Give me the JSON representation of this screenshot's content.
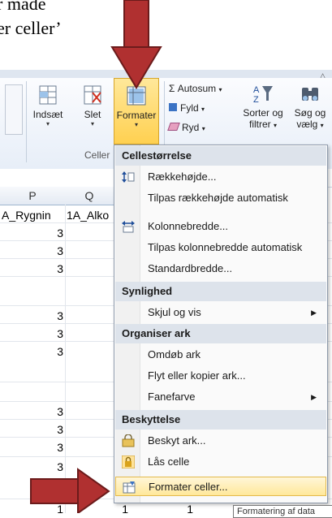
{
  "instruction": {
    "line1": "r måde",
    "line2": "er celler’"
  },
  "ribbon": {
    "insert_label": "Indsæt",
    "delete_label": "Slet",
    "format_label": "Formater",
    "cells_group_label": "Celler",
    "autosum_label": "Σ  Autosum",
    "fill_label": "Fyld",
    "clear_label": "Ryd",
    "sort_filter_label_1": "Sorter og",
    "sort_filter_label_2": "filtrer",
    "find_select_label_1": "Søg og",
    "find_select_label_2": "vælg"
  },
  "sheet": {
    "column_headers": [
      "P",
      "Q"
    ],
    "header_cells": [
      "A_Rygnin",
      "1A_Alko"
    ],
    "col_p_values": [
      "3",
      "3",
      "3",
      "",
      "3",
      "3",
      "3",
      "",
      "",
      "3",
      "3",
      "3",
      "3",
      "",
      "1"
    ],
    "bottom_row": [
      "1",
      "1",
      "1"
    ]
  },
  "menu": {
    "section_cell_size": "Cellestørrelse",
    "row_height": "Rækkehøjde...",
    "autofit_row_height": "Tilpas rækkehøjde automatisk",
    "column_width": "Kolonnebredde...",
    "autofit_column_width": "Tilpas kolonnebredde automatisk",
    "default_width": "Standardbredde...",
    "section_visibility": "Synlighed",
    "hide_unhide": "Skjul og vis",
    "section_organize": "Organiser ark",
    "rename_sheet": "Omdøb ark",
    "move_copy_sheet": "Flyt eller kopier ark...",
    "tab_color": "Fanefarve",
    "section_protection": "Beskyttelse",
    "protect_sheet": "Beskyt ark...",
    "lock_cell": "Lås celle",
    "format_cells": "Formater celler..."
  },
  "tooltip": {
    "text": "Formatering af data"
  },
  "colors": {
    "arrow": "#b03030",
    "highlight": "#ffe89a",
    "ribbon_bg": "#e7eef8"
  }
}
